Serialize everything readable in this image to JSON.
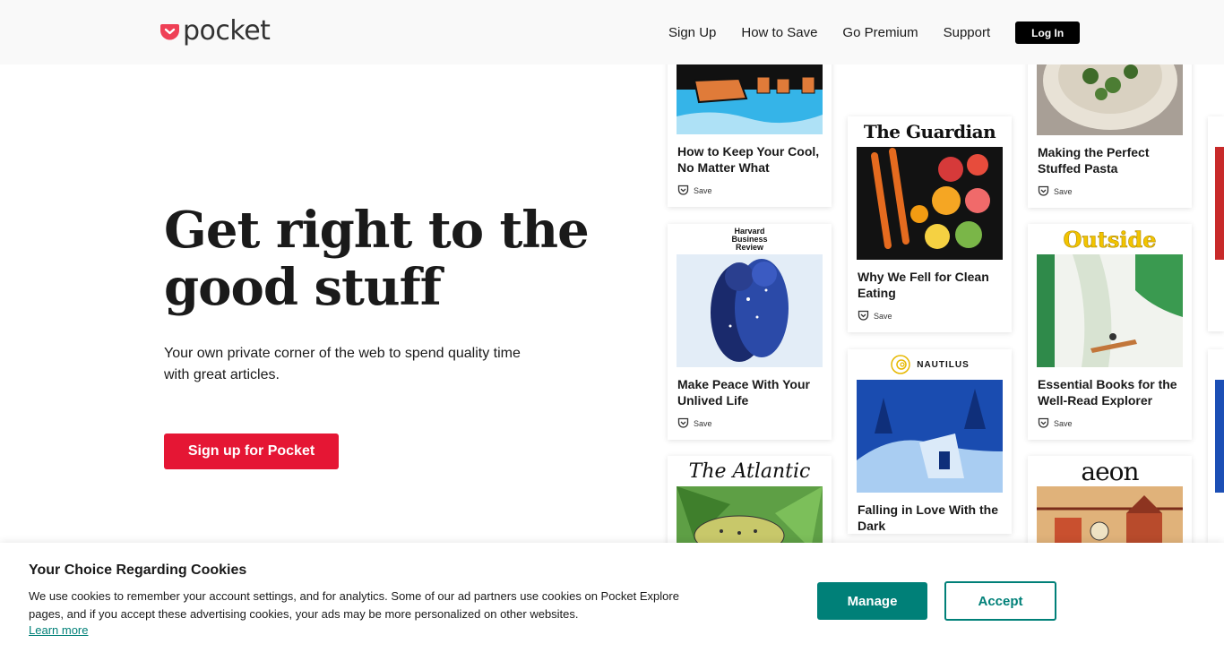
{
  "header": {
    "logo_text": "pocket",
    "nav": {
      "sign_up": "Sign Up",
      "how_to_save": "How to Save",
      "go_premium": "Go Premium",
      "support": "Support",
      "log_in": "Log In"
    }
  },
  "hero": {
    "title": "Get right to the good stuff",
    "subtitle": "Your own private corner of the web to spend quality time with great articles.",
    "cta": "Sign up for Pocket"
  },
  "cards": {
    "save_label": "Save",
    "items": [
      {
        "publisher": "",
        "title": "How to Keep Your Cool, No Matter What"
      },
      {
        "publisher": "The Guardian",
        "title": "Why We Fell for Clean Eating"
      },
      {
        "publisher": "",
        "title": "Making the Perfect Stuffed Pasta"
      },
      {
        "publisher": "Harvard Business Review",
        "title": "Make Peace With Your Unlived Life"
      },
      {
        "publisher": "Outside",
        "title": "Essential Books for the Well-Read Explorer"
      },
      {
        "publisher": "NAUTILUS",
        "title": "Falling in Love With the Dark"
      },
      {
        "publisher": "The Atlantic",
        "title": ""
      },
      {
        "publisher": "aeon",
        "title": ""
      }
    ]
  },
  "cookie": {
    "heading": "Your Choice Regarding Cookies",
    "body": "We use cookies to remember your account settings, and for analytics. Some of our ad partners use cookies on Pocket Explore pages, and if you accept these advertising cookies, your ads may be more personalized on other websites.",
    "learn_more": "Learn more",
    "manage": "Manage",
    "accept": "Accept"
  },
  "colors": {
    "brand_red": "#ef4056",
    "cta_red": "#e51634",
    "teal": "#008078"
  }
}
